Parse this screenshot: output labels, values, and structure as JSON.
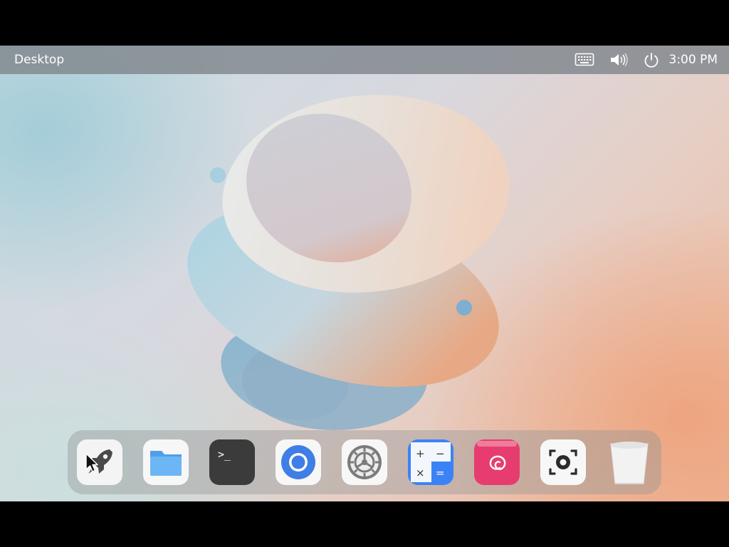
{
  "topbar": {
    "title": "Desktop",
    "clock": "3:00 PM",
    "tray_icons": [
      "keyboard-icon",
      "volume-icon",
      "power-icon"
    ]
  },
  "dock": {
    "items": [
      {
        "name": "launcher",
        "icon": "rocket-icon"
      },
      {
        "name": "files",
        "icon": "folder-icon"
      },
      {
        "name": "terminal",
        "icon": "terminal-icon",
        "glyph": ">_"
      },
      {
        "name": "browser",
        "icon": "chromium-icon"
      },
      {
        "name": "settings",
        "icon": "gear-icon"
      },
      {
        "name": "calculator",
        "icon": "calculator-icon",
        "glyphs": [
          "+",
          "−",
          "×",
          "="
        ]
      },
      {
        "name": "debian-app",
        "icon": "debian-swirl-icon"
      },
      {
        "name": "screenshot",
        "icon": "screenshot-icon"
      },
      {
        "name": "trash",
        "icon": "trash-icon"
      }
    ]
  },
  "colors": {
    "topbar_bg": "#80868c",
    "dock_bg": "#969696",
    "calc_accent": "#3b82f6",
    "debian_pink": "#e63d6e",
    "folder_blue": "#5aa9f0"
  }
}
